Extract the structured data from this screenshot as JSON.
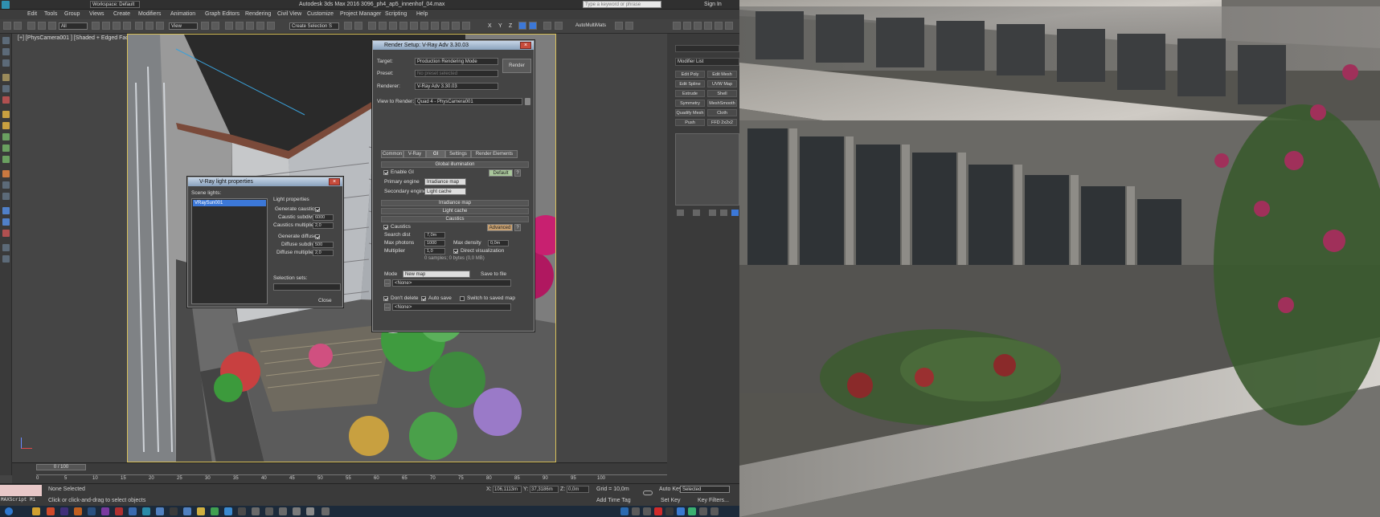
{
  "window": {
    "title": "Autodesk 3ds Max 2016    3096_ph4_ap5_innenhof_04.max",
    "workspace": "Workspace: Default",
    "search_placeholder": "Type a keyword or phrase",
    "sign_in": "Sign In"
  },
  "menu": [
    "Edit",
    "Tools",
    "Group",
    "Views",
    "Create",
    "Modifiers",
    "Animation",
    "Graph Editors",
    "Rendering",
    "Civil View",
    "Customize",
    "Project Manager",
    "Scripting",
    "Help"
  ],
  "toolbar": {
    "filter": "All",
    "coord": "View",
    "selection_set": "Create Selection S",
    "axes": [
      "X",
      "Y",
      "Z"
    ],
    "automultimats": "AutoMultiMats"
  },
  "viewport": {
    "label": "[+] [PhysCamera001 ] [Shaded + Edged Faces ]"
  },
  "command_panel": {
    "modifier_list": "Modifier List",
    "buttons": [
      "Edit Poly",
      "Edit Mesh",
      "Edit Spline",
      "UVW Map",
      "Extrude",
      "Shell",
      "Symmetry",
      "MeshSmooth",
      "Quadify Mesh",
      "Cloth",
      "Push",
      "FFD 2x2x2"
    ]
  },
  "render_setup": {
    "title": "Render Setup: V-Ray Adv 3.30.03",
    "target_label": "Target:",
    "target": "Production Rendering Mode",
    "preset_label": "Preset:",
    "preset": "No preset selected",
    "renderer_label": "Renderer:",
    "renderer": "V-Ray Adv 3.30.03",
    "view_label": "View to Render:",
    "view": "Quad 4 - PhysCamera001",
    "render_button": "Render",
    "tabs": [
      "Common",
      "V-Ray",
      "GI",
      "Settings",
      "Render Elements"
    ],
    "gi_rollout": "Global illumination",
    "enable_gi": "Enable GI",
    "default_button": "Default",
    "primary_label": "Primary engine",
    "primary": "Irradiance map",
    "secondary_label": "Secondary engine",
    "secondary": "Light cache",
    "irradiance_rollout": "Irradiance map",
    "lightcache_rollout": "Light cache",
    "caustics_rollout": "Caustics",
    "caustics_label": "Caustics",
    "advanced_button": "Advanced",
    "search_dist_label": "Search dist",
    "search_dist": "7,0m",
    "max_photons_label": "Max photons",
    "max_photons": "1000",
    "max_density_label": "Max density",
    "max_density": "0,0m",
    "multiplier_label": "Multiplier",
    "multiplier": "1,0",
    "direct_vis_label": "Direct visualization",
    "samples_info": "0 samples; 0 bytes (0,0 MB)",
    "mode_label": "Mode",
    "mode": "New map",
    "save_to_file": "Save to file",
    "none1": "<None>",
    "dont_delete": "Don't delete",
    "auto_save": "Auto save",
    "switch_saved": "Switch to saved map",
    "none2": "<None>"
  },
  "light_props": {
    "title": "V-Ray light properties",
    "scene_lights_label": "Scene lights:",
    "lights": [
      "VRaySun001"
    ],
    "light_properties": "Light properties",
    "gen_caustics": "Generate caustics",
    "caustic_subdivs_label": "Caustic subdivs",
    "caustic_subdivs": "6000",
    "caustics_mult_label": "Caustics multiplier",
    "caustics_mult": "2,0",
    "gen_diffuse": "Generate diffuse",
    "diffuse_subdivs_label": "Diffuse subdivs",
    "diffuse_subdivs": "500",
    "diffuse_mult_label": "Diffuse multiplier",
    "diffuse_mult": "2,0",
    "selection_sets_label": "Selection sets:",
    "close_button": "Close"
  },
  "timeline": {
    "frame": "0 / 100",
    "ticks": [
      "0",
      "5",
      "10",
      "15",
      "20",
      "25",
      "30",
      "35",
      "40",
      "45",
      "50",
      "55",
      "60",
      "65",
      "70",
      "75",
      "80",
      "85",
      "90",
      "95",
      "100"
    ]
  },
  "status": {
    "selection": "None Selected",
    "prompt": "Click or click-and-drag to select objects",
    "x_label": "X:",
    "x": "106,1113m",
    "y_label": "Y:",
    "y": "37,3186m",
    "z_label": "Z:",
    "z": "0,0m",
    "grid": "Grid = 10,0m",
    "add_time_tag": "Add Time Tag",
    "auto_key": "Auto Key",
    "auto_key_mode": "Selected",
    "set_key": "Set Key",
    "key_filters": "Key Filters...",
    "maxscript": "MAXScript Mi"
  },
  "colors": {
    "accent": "#3c78d8",
    "viewport_border": "#d8c05a",
    "close": "#c74b3b"
  }
}
